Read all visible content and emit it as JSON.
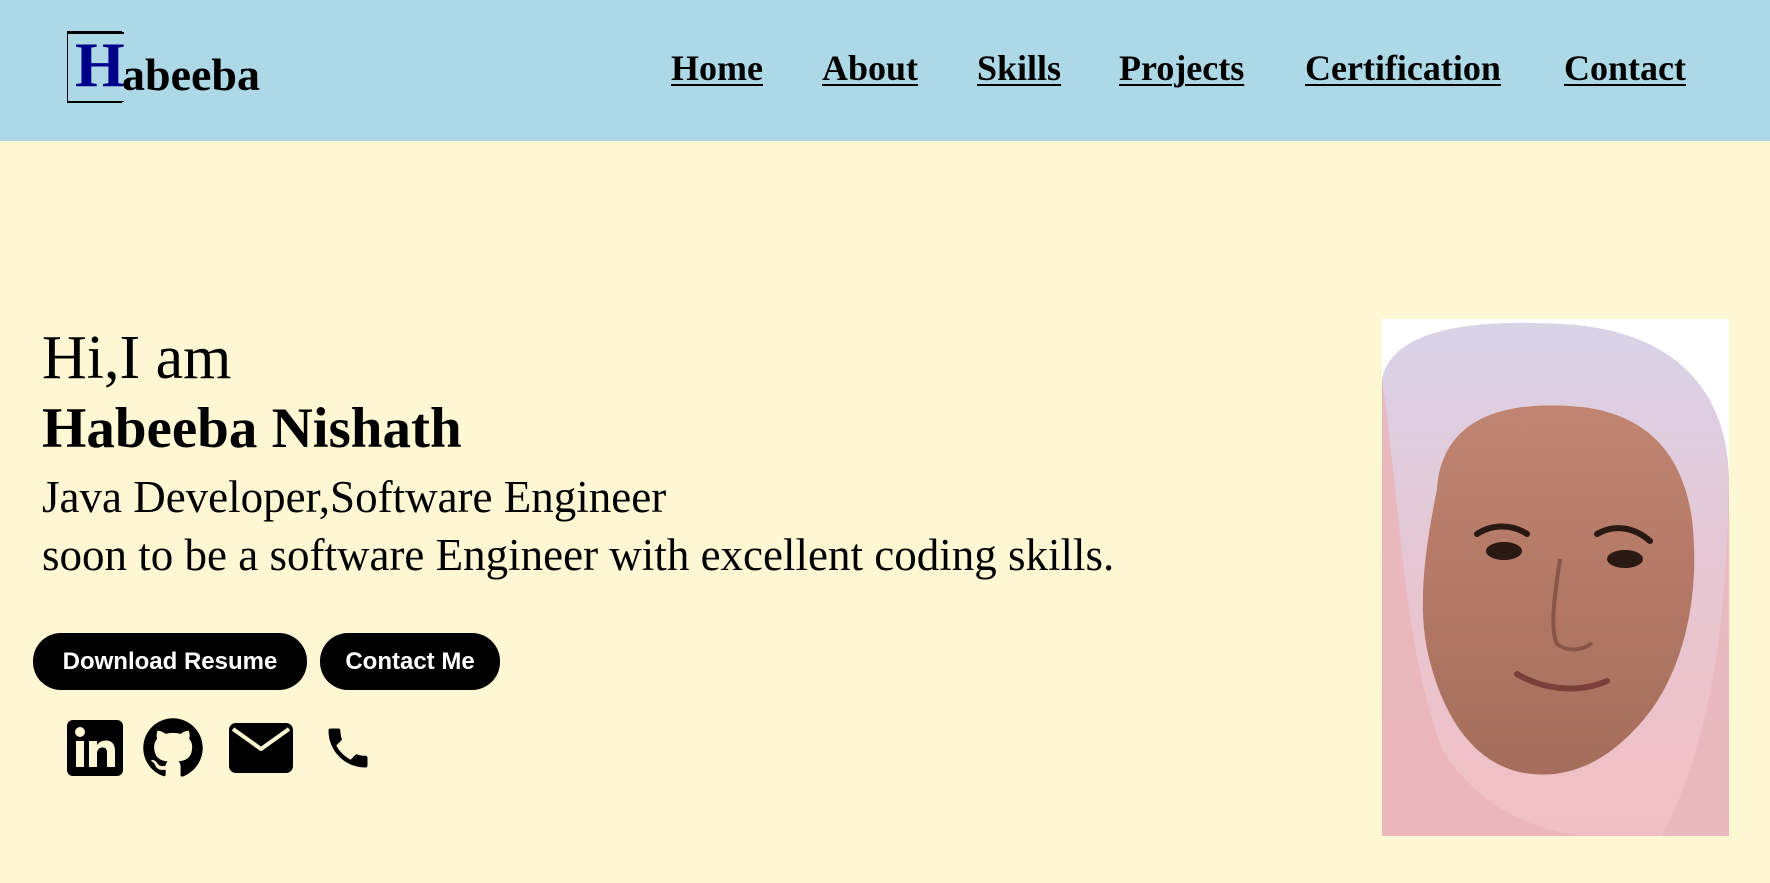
{
  "logo": {
    "initial": "H",
    "rest": "abeeba",
    "initial_color": "#00008b"
  },
  "nav": {
    "items": [
      {
        "label": "Home"
      },
      {
        "label": "About"
      },
      {
        "label": "Skills"
      },
      {
        "label": "Projects"
      },
      {
        "label": "Certification"
      },
      {
        "label": "Contact"
      }
    ]
  },
  "hero": {
    "greeting": "Hi,I am",
    "name": "Habeeba Nishath",
    "role": "Java Developer,Software Engineer",
    "tagline": "soon to be a software Engineer with excellent coding skills."
  },
  "buttons": {
    "download_resume": "Download Resume",
    "contact_me": "Contact Me"
  },
  "social": [
    {
      "icon": "linkedin-icon"
    },
    {
      "icon": "github-icon"
    },
    {
      "icon": "mail-icon"
    },
    {
      "icon": "phone-icon"
    }
  ],
  "colors": {
    "header_bg": "#add8e6",
    "page_bg": "#fdf7d4",
    "button_bg": "#000000",
    "button_text": "#ffffff"
  }
}
